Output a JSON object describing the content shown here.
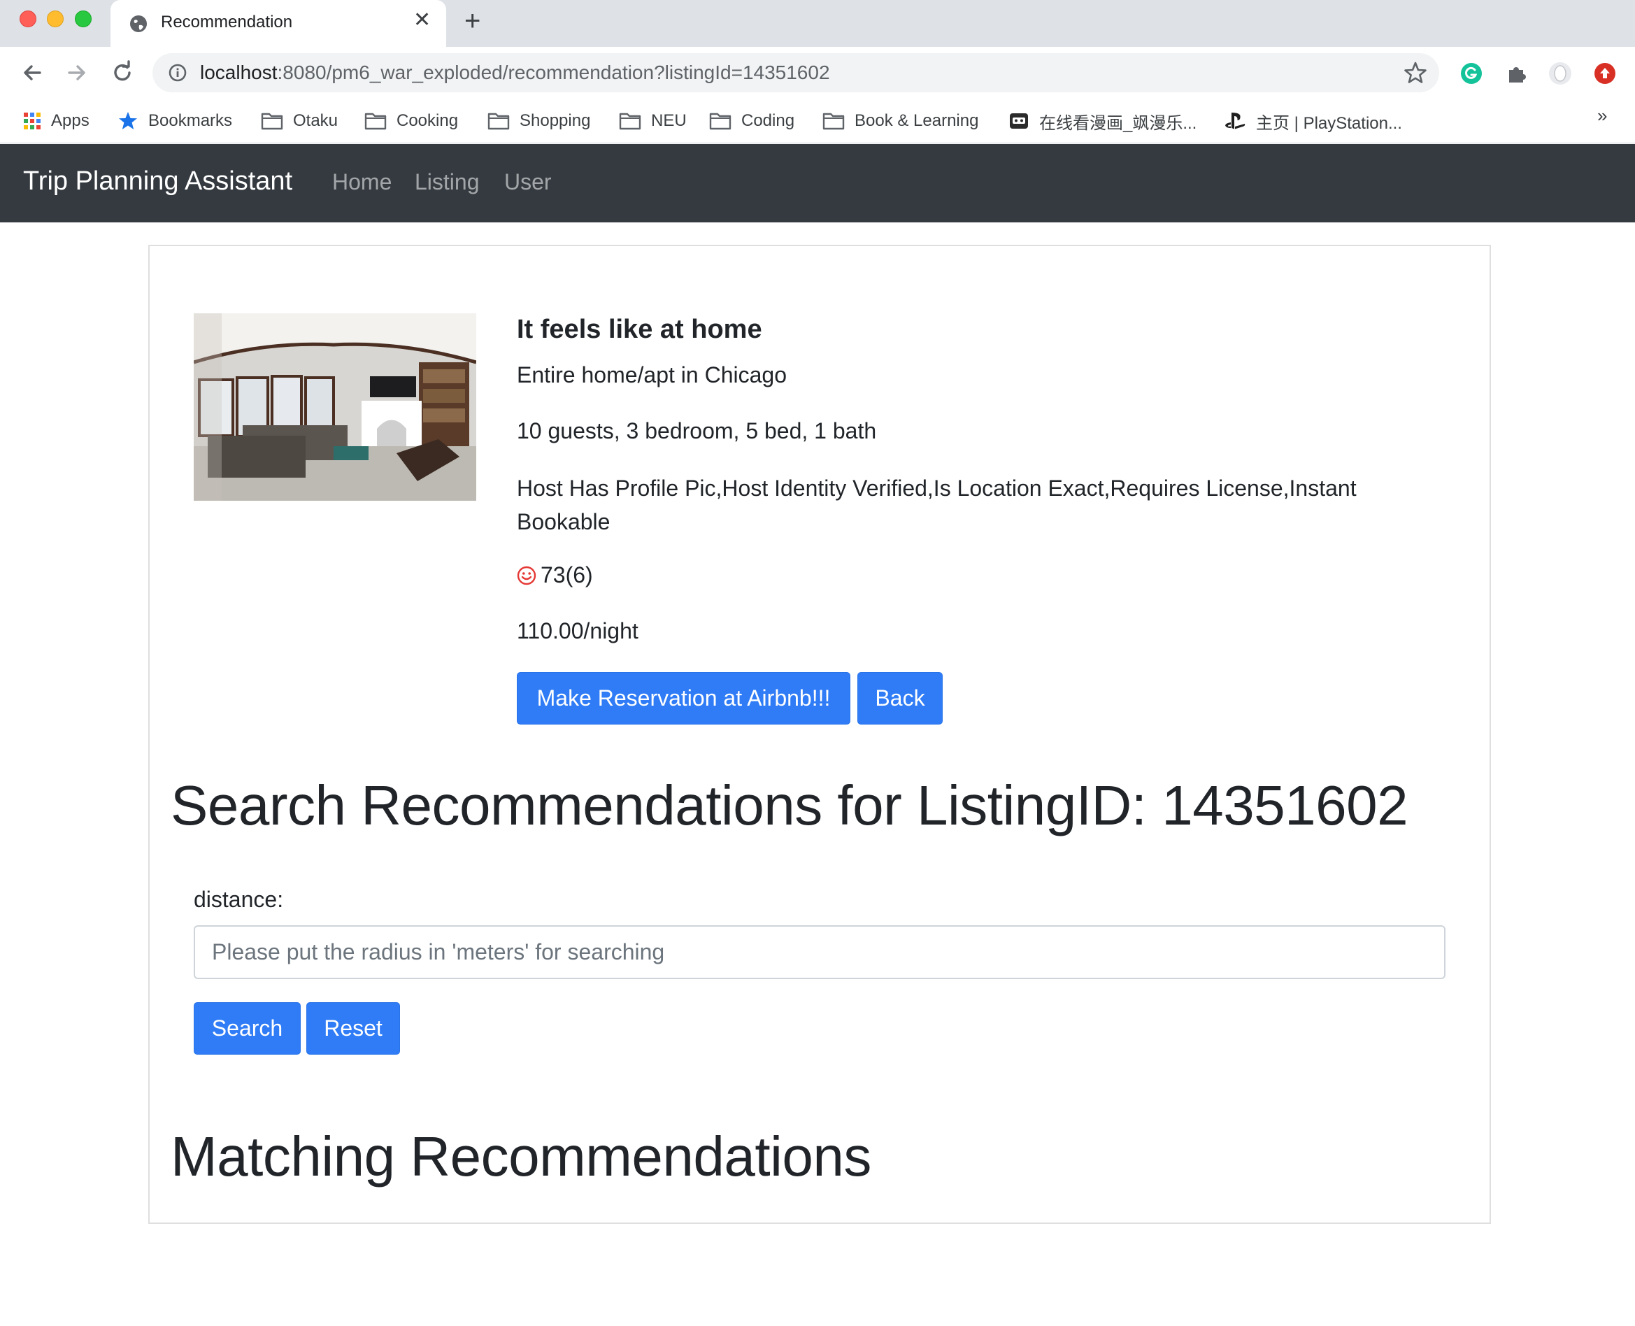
{
  "browser": {
    "tab_title": "Recommendation",
    "url_host": "localhost",
    "url_rest": ":8080/pm6_war_exploded/recommendation?listingId=14351602",
    "bookmarks": [
      {
        "label": "Apps",
        "icon": "apps-grid-icon"
      },
      {
        "label": "Bookmarks",
        "icon": "star-icon"
      },
      {
        "label": "Otaku",
        "icon": "folder-icon"
      },
      {
        "label": "Cooking",
        "icon": "folder-icon"
      },
      {
        "label": "Shopping",
        "icon": "folder-icon"
      },
      {
        "label": "NEU",
        "icon": "folder-icon"
      },
      {
        "label": "Coding",
        "icon": "folder-icon"
      },
      {
        "label": "Book & Learning",
        "icon": "folder-icon"
      },
      {
        "label": "在线看漫画_飒漫乐...",
        "icon": "site-icon"
      },
      {
        "label": "主页 | PlayStation...",
        "icon": "playstation-icon"
      }
    ],
    "more_bookmarks": "»"
  },
  "navbar": {
    "brand": "Trip Planning Assistant",
    "links": [
      "Home",
      "Listing",
      "User"
    ]
  },
  "listing": {
    "name": "It feels like at home",
    "room_type": "Entire home/apt in Chicago",
    "capacity": "10 guests, 3 bedroom, 5 bed, 1 bath",
    "features": "Host Has Profile Pic,Host Identity Verified,Is Location Exact,Requires License,Instant Bookable",
    "rating": "73(6)",
    "price": "110.00/night",
    "reserve_label": "Make Reservation at Airbnb!!!",
    "back_label": "Back"
  },
  "search": {
    "heading": "Search Recommendations for ListingID: 14351602",
    "distance_label": "distance:",
    "distance_placeholder": "Please put the radius in 'meters' for searching",
    "distance_value": "",
    "search_label": "Search",
    "reset_label": "Reset"
  },
  "results": {
    "heading": "Matching Recommendations"
  },
  "colors": {
    "navbar_bg": "#343a40",
    "primary_button": "#2f7cf6",
    "rating_icon": "#e53935"
  }
}
